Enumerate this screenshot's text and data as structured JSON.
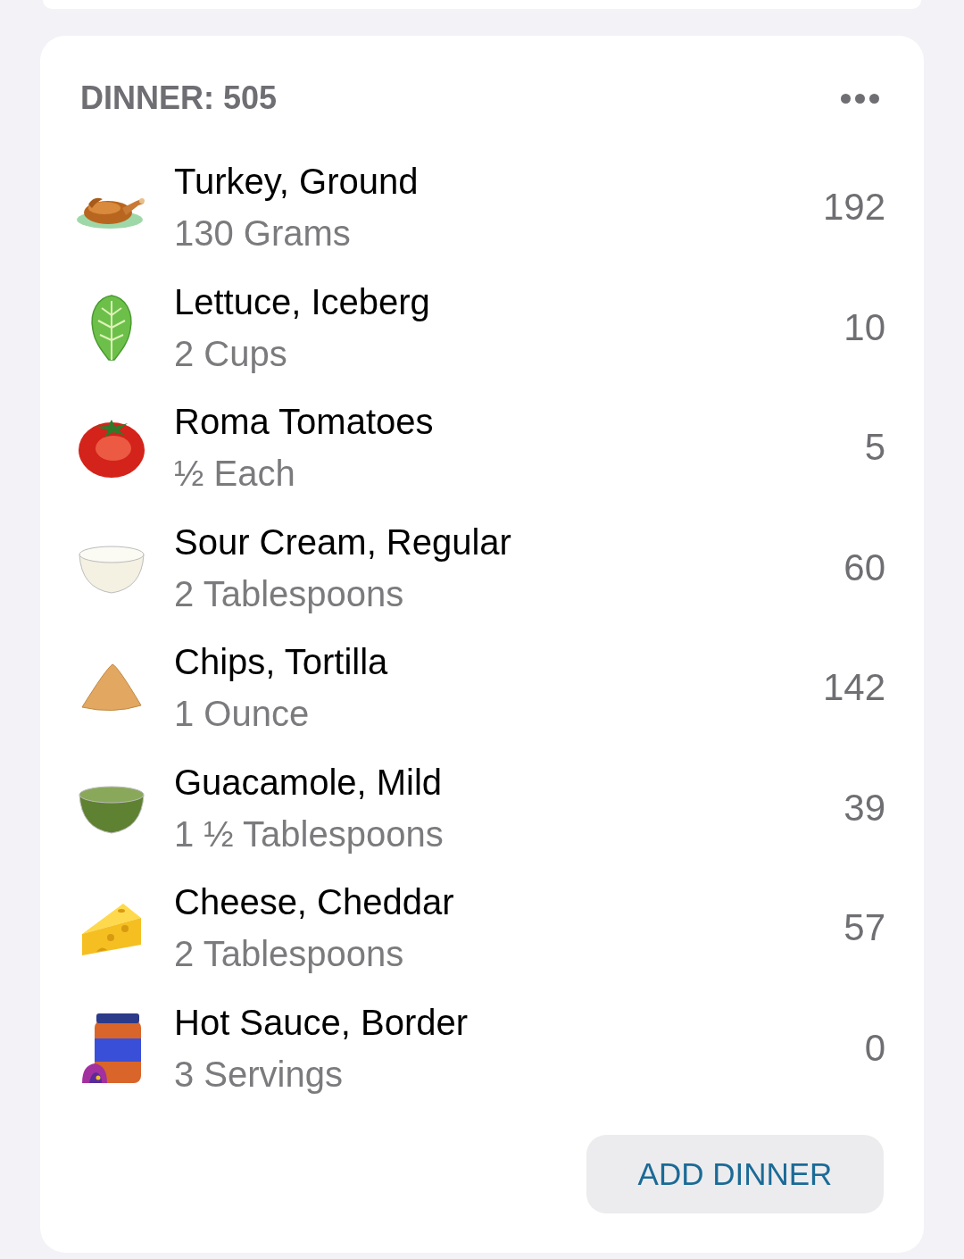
{
  "meal": {
    "title": "DINNER: 505"
  },
  "foods": [
    {
      "kind": "turkey",
      "name": "Turkey, Ground",
      "serving": "130 Grams",
      "calories": "192"
    },
    {
      "kind": "lettuce",
      "name": "Lettuce, Iceberg",
      "serving": "2 Cups",
      "calories": "10"
    },
    {
      "kind": "tomato",
      "name": "Roma Tomatoes",
      "serving": "½ Each",
      "calories": "5"
    },
    {
      "kind": "sourcream",
      "name": "Sour Cream, Regular",
      "serving": "2 Tablespoons",
      "calories": "60"
    },
    {
      "kind": "chip",
      "name": "Chips, Tortilla",
      "serving": "1 Ounce",
      "calories": "142"
    },
    {
      "kind": "guacamole",
      "name": "Guacamole, Mild",
      "serving": "1 ½ Tablespoons",
      "calories": "39"
    },
    {
      "kind": "cheese",
      "name": "Cheese, Cheddar",
      "serving": "2 Tablespoons",
      "calories": "57"
    },
    {
      "kind": "sauce",
      "name": "Hot Sauce, Border",
      "serving": "3 Servings",
      "calories": "0"
    }
  ],
  "add_button": {
    "label": "ADD DINNER"
  }
}
